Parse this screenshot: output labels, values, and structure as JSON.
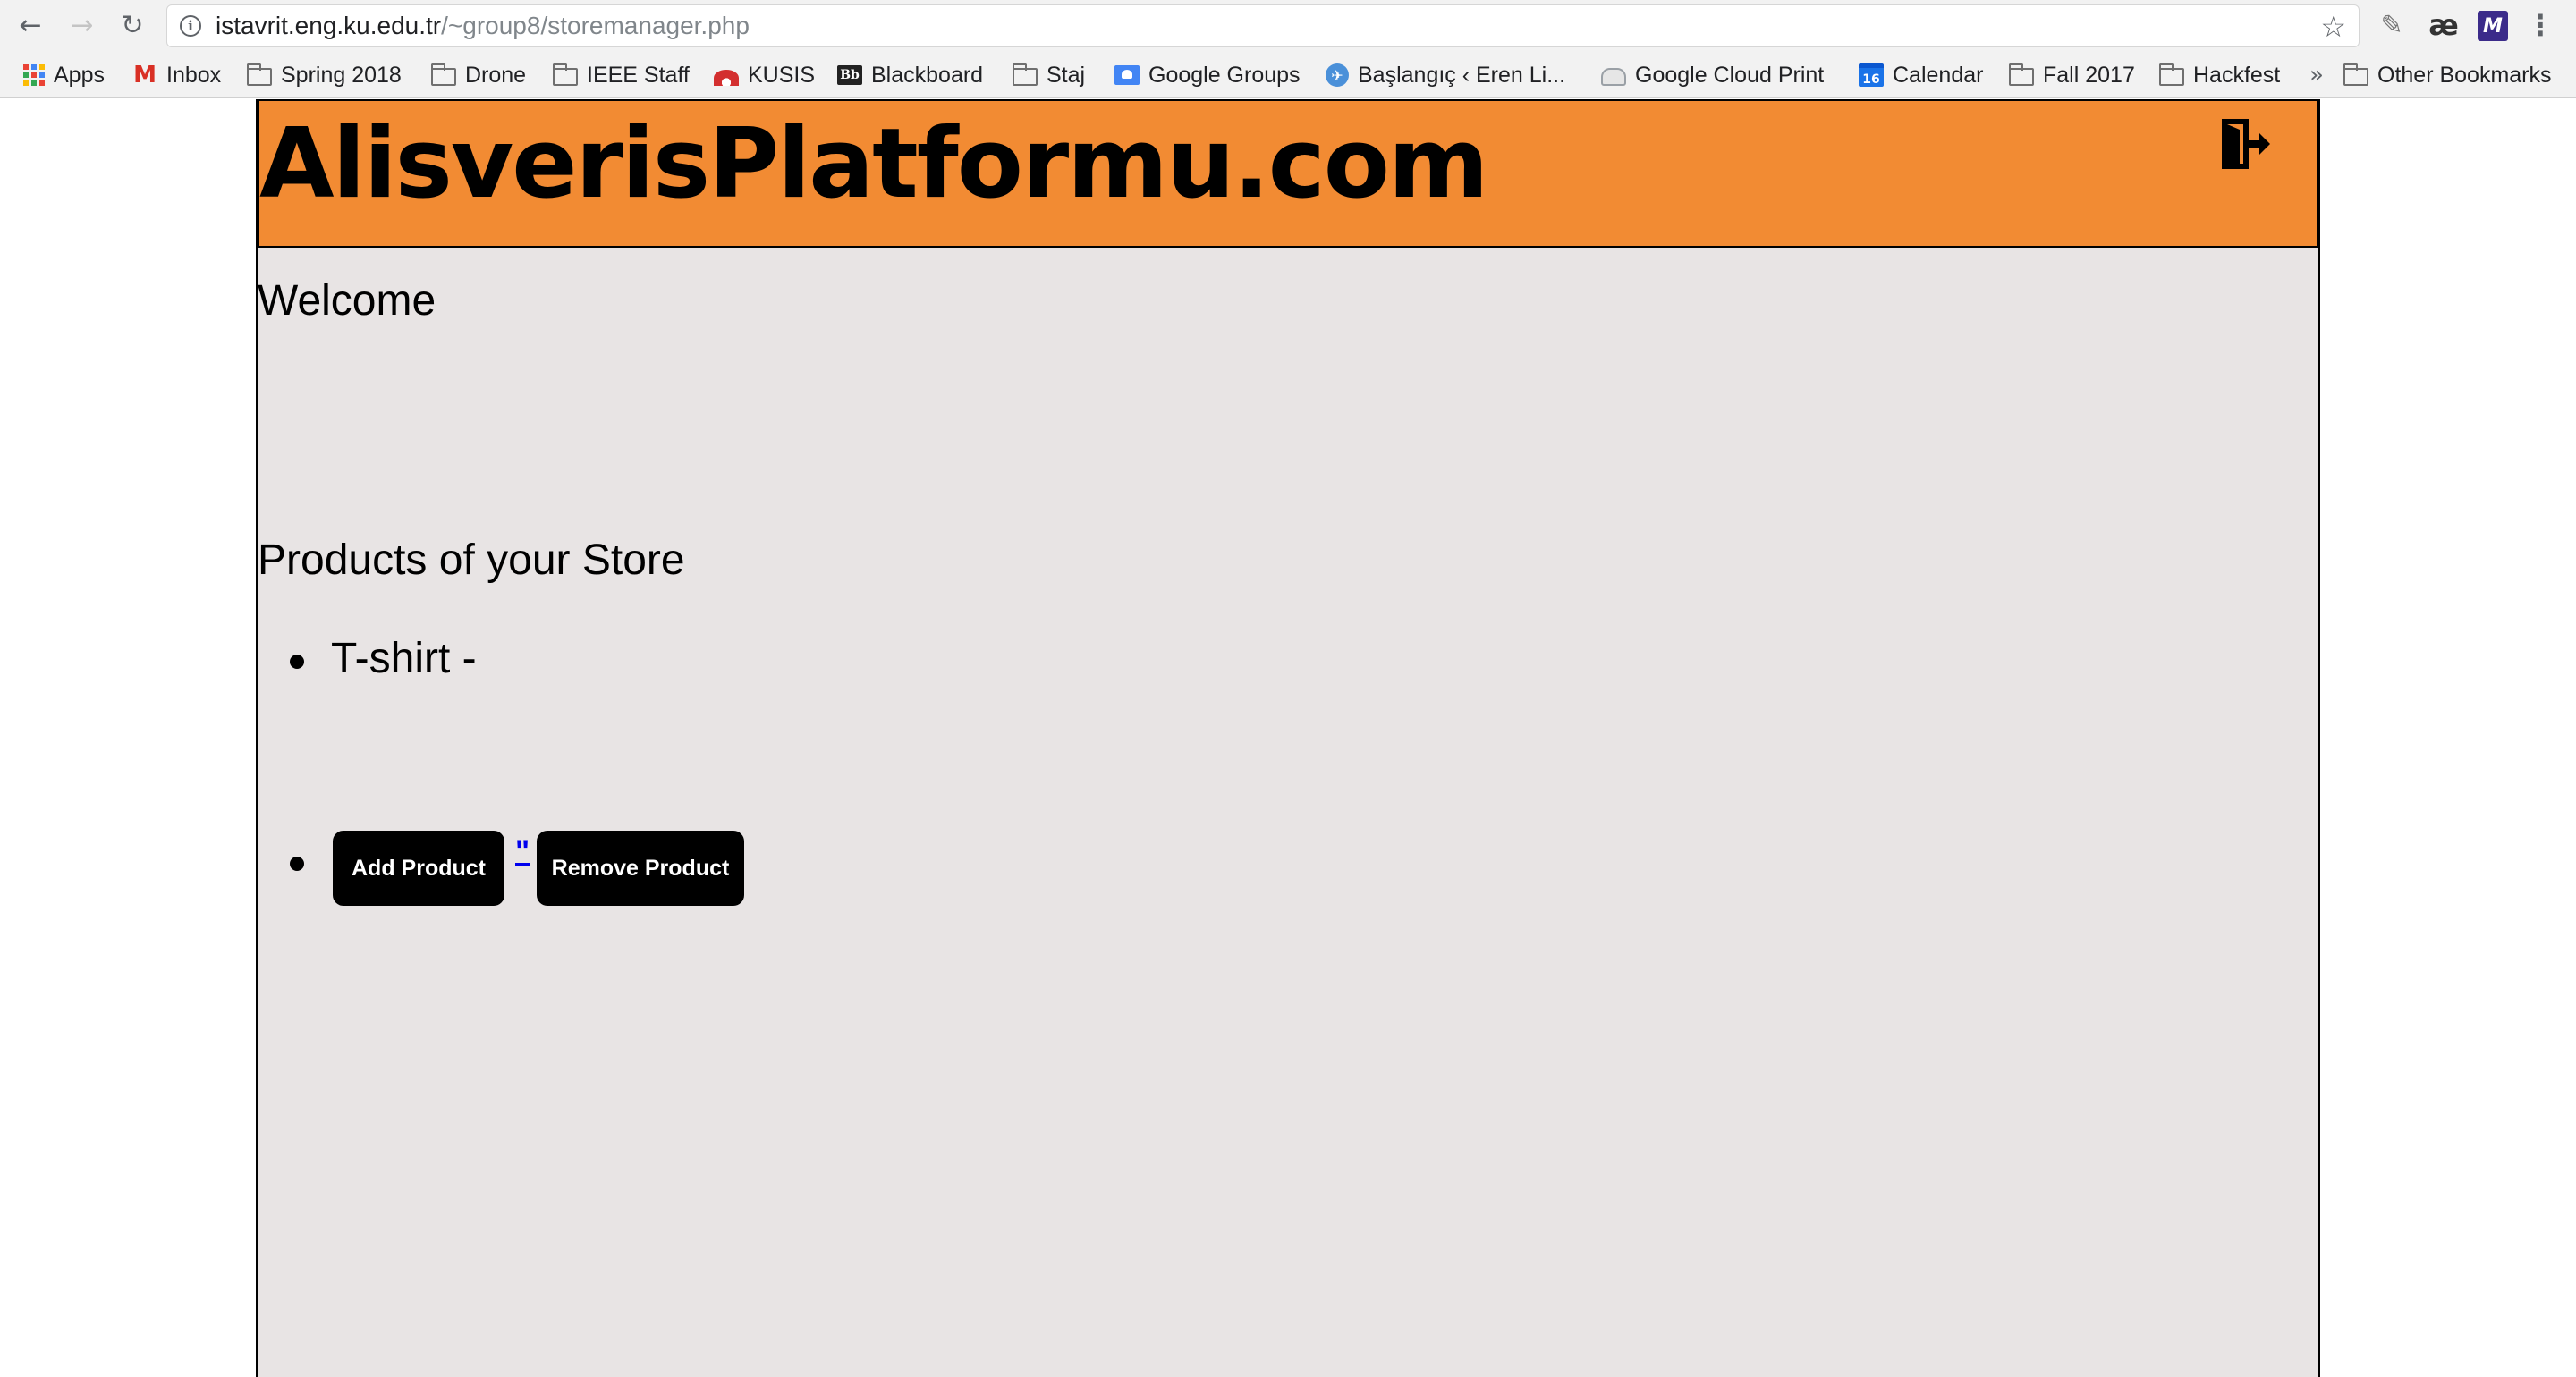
{
  "browser": {
    "url_host": "istavrit.eng.ku.edu.tr",
    "url_path": "/~group8/storemanager.php",
    "icons": {
      "back": "arrow-left-icon",
      "forward": "arrow-right-icon",
      "reload": "reload-icon",
      "info": "info-icon",
      "bookmark_star": "star-icon",
      "menu": "kebab-menu-icon"
    },
    "extensions": {
      "ae_label": "æ",
      "m_label": "M"
    }
  },
  "bookmarks": {
    "items": [
      {
        "label": "Apps",
        "icon": "apps-grid-icon"
      },
      {
        "label": "Inbox",
        "icon": "gmail-icon"
      },
      {
        "label": "Spring 2018",
        "icon": "folder-icon"
      },
      {
        "label": "Drone",
        "icon": "folder-icon"
      },
      {
        "label": "IEEE Staff",
        "icon": "folder-icon"
      },
      {
        "label": "KUSIS",
        "icon": "kusis-icon"
      },
      {
        "label": "Blackboard",
        "icon": "blackboard-icon"
      },
      {
        "label": "Staj",
        "icon": "folder-icon"
      },
      {
        "label": "Google Groups",
        "icon": "google-groups-icon"
      },
      {
        "label": "Başlangıç ‹ Eren Li...",
        "icon": "plane-icon"
      },
      {
        "label": "Google Cloud Print",
        "icon": "cloud-print-icon"
      },
      {
        "label": "Calendar",
        "icon": "calendar-icon"
      },
      {
        "label": "Fall 2017",
        "icon": "folder-icon"
      },
      {
        "label": "Hackfest",
        "icon": "folder-icon"
      }
    ],
    "overflow": "»",
    "other": "Other Bookmarks",
    "calendar_day": "16",
    "blackboard_glyph": "Bb"
  },
  "site": {
    "title": "AlisverisPlatformu.com",
    "header_color": "#f28b33",
    "body_color": "#e8e4e4",
    "welcome": "Welcome",
    "section_title": "Products of your Store",
    "products": [
      {
        "label": "T-shirt -"
      }
    ],
    "add_button": "Add Product",
    "link_text": "\"",
    "remove_button": "Remove Product"
  }
}
